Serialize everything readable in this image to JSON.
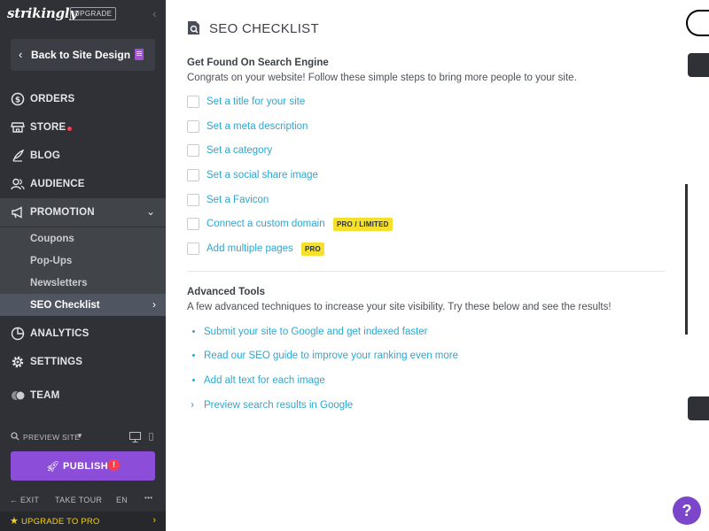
{
  "sidebar": {
    "brand": "strikingly",
    "upgrade_tag": "UPGRADE",
    "back_label": "Back to Site Design",
    "nav": {
      "orders": "ORDERS",
      "store": "STORE",
      "blog": "BLOG",
      "audience": "AUDIENCE",
      "promotion": "PROMOTION",
      "analytics": "ANALYTICS",
      "settings": "SETTINGS",
      "team": "TEAM"
    },
    "promotion_sub": {
      "coupons": "Coupons",
      "popups": "Pop-Ups",
      "newsletters": "Newsletters",
      "seo": "SEO Checklist"
    },
    "preview_label": "PREVIEW SITE",
    "publish_label": "PUBLISH",
    "publish_alert": "!",
    "bottom": {
      "exit": "EXIT",
      "tour": "TAKE TOUR",
      "lang": "EN",
      "more": "•••"
    },
    "upgrade_pro": "UPGRADE TO PRO"
  },
  "panel": {
    "title": "SEO CHECKLIST",
    "found": {
      "heading": "Get Found On Search Engine",
      "description": "Congrats on your website! Follow these simple steps to bring more people to your site.",
      "items": [
        {
          "label": "Set a title for your site",
          "badge": ""
        },
        {
          "label": "Set a meta description",
          "badge": ""
        },
        {
          "label": "Set a category",
          "badge": ""
        },
        {
          "label": "Set a social share image",
          "badge": ""
        },
        {
          "label": "Set a Favicon",
          "badge": ""
        },
        {
          "label": "Connect a custom domain",
          "badge": "PRO / LIMITED"
        },
        {
          "label": "Add multiple pages",
          "badge": "PRO"
        }
      ]
    },
    "advanced": {
      "heading": "Advanced Tools",
      "description": "A few advanced techniques to increase your site visibility. Try these below and see the results!",
      "items": [
        "Submit your site to Google and get indexed faster",
        "Read our SEO guide to improve your ranking even more",
        "Add alt text for each image",
        "Preview search results in Google"
      ]
    }
  },
  "help": "?",
  "colors": {
    "sidebar_bg": "#2f3136",
    "accent_link": "#2aa8d2",
    "publish": "#8c4ed8",
    "pro_badge": "#f5e12b",
    "alert_red": "#ff3b4f"
  }
}
